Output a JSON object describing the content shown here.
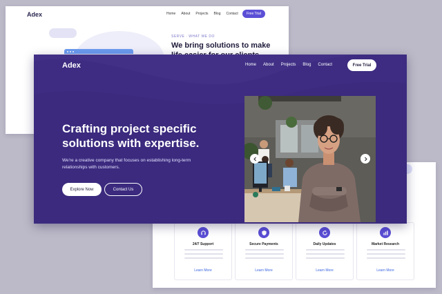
{
  "back_card": {
    "logo": "Adex",
    "nav": [
      "Home",
      "About",
      "Projects",
      "Blog",
      "Contact"
    ],
    "cta": "Free Trial",
    "eyebrow": "SERVE · WHAT WE DO",
    "heading": "We bring solutions to make life easier for our clients."
  },
  "hero": {
    "logo": "Adex",
    "nav": [
      "Home",
      "About",
      "Projects",
      "Blog",
      "Contact"
    ],
    "cta": "Free Trial",
    "headline": "Crafting project specific solutions with expertise.",
    "subtext": "We're a creative company that focuses on establishing long-term relationships with customers.",
    "primary_button": "Explore Now",
    "secondary_button": "Contact Us"
  },
  "features": [
    {
      "title": "24/7 Support",
      "link": "Learn More",
      "icon": "support-icon"
    },
    {
      "title": "Secure Payments",
      "link": "Learn More",
      "icon": "shield-icon"
    },
    {
      "title": "Daily Updates",
      "link": "Learn More",
      "icon": "refresh-icon"
    },
    {
      "title": "Market Research",
      "link": "Learn More",
      "icon": "chart-icon"
    }
  ],
  "colors": {
    "brand_purple": "#3b2a7e",
    "accent": "#5b4fd6",
    "link_blue": "#3a66e0"
  }
}
